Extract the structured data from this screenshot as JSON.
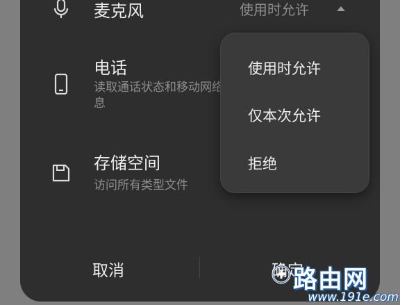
{
  "permissions": [
    {
      "title": "麦克风",
      "value": "使用时允许",
      "icon": "microphone-icon"
    },
    {
      "title": "电话",
      "subtitle": "读取通话状态和移动网络信息",
      "icon": "phone-icon"
    },
    {
      "title": "存储空间",
      "subtitle": "访问所有类型文件",
      "icon": "storage-icon"
    }
  ],
  "dropdown": {
    "options": [
      "使用时允许",
      "仅本次允许",
      "拒绝"
    ]
  },
  "footer": {
    "cancel_label": "取消",
    "confirm_label": "确定"
  },
  "watermark": {
    "text": "路由网",
    "url": "www.191e.com"
  },
  "colors": {
    "sheet_background": "#2e2e2e",
    "menu_background": "#3a3a3a",
    "primary_text": "#eeeeee",
    "secondary_text": "#8e8e8e",
    "overlay": "#7f7f7f"
  }
}
